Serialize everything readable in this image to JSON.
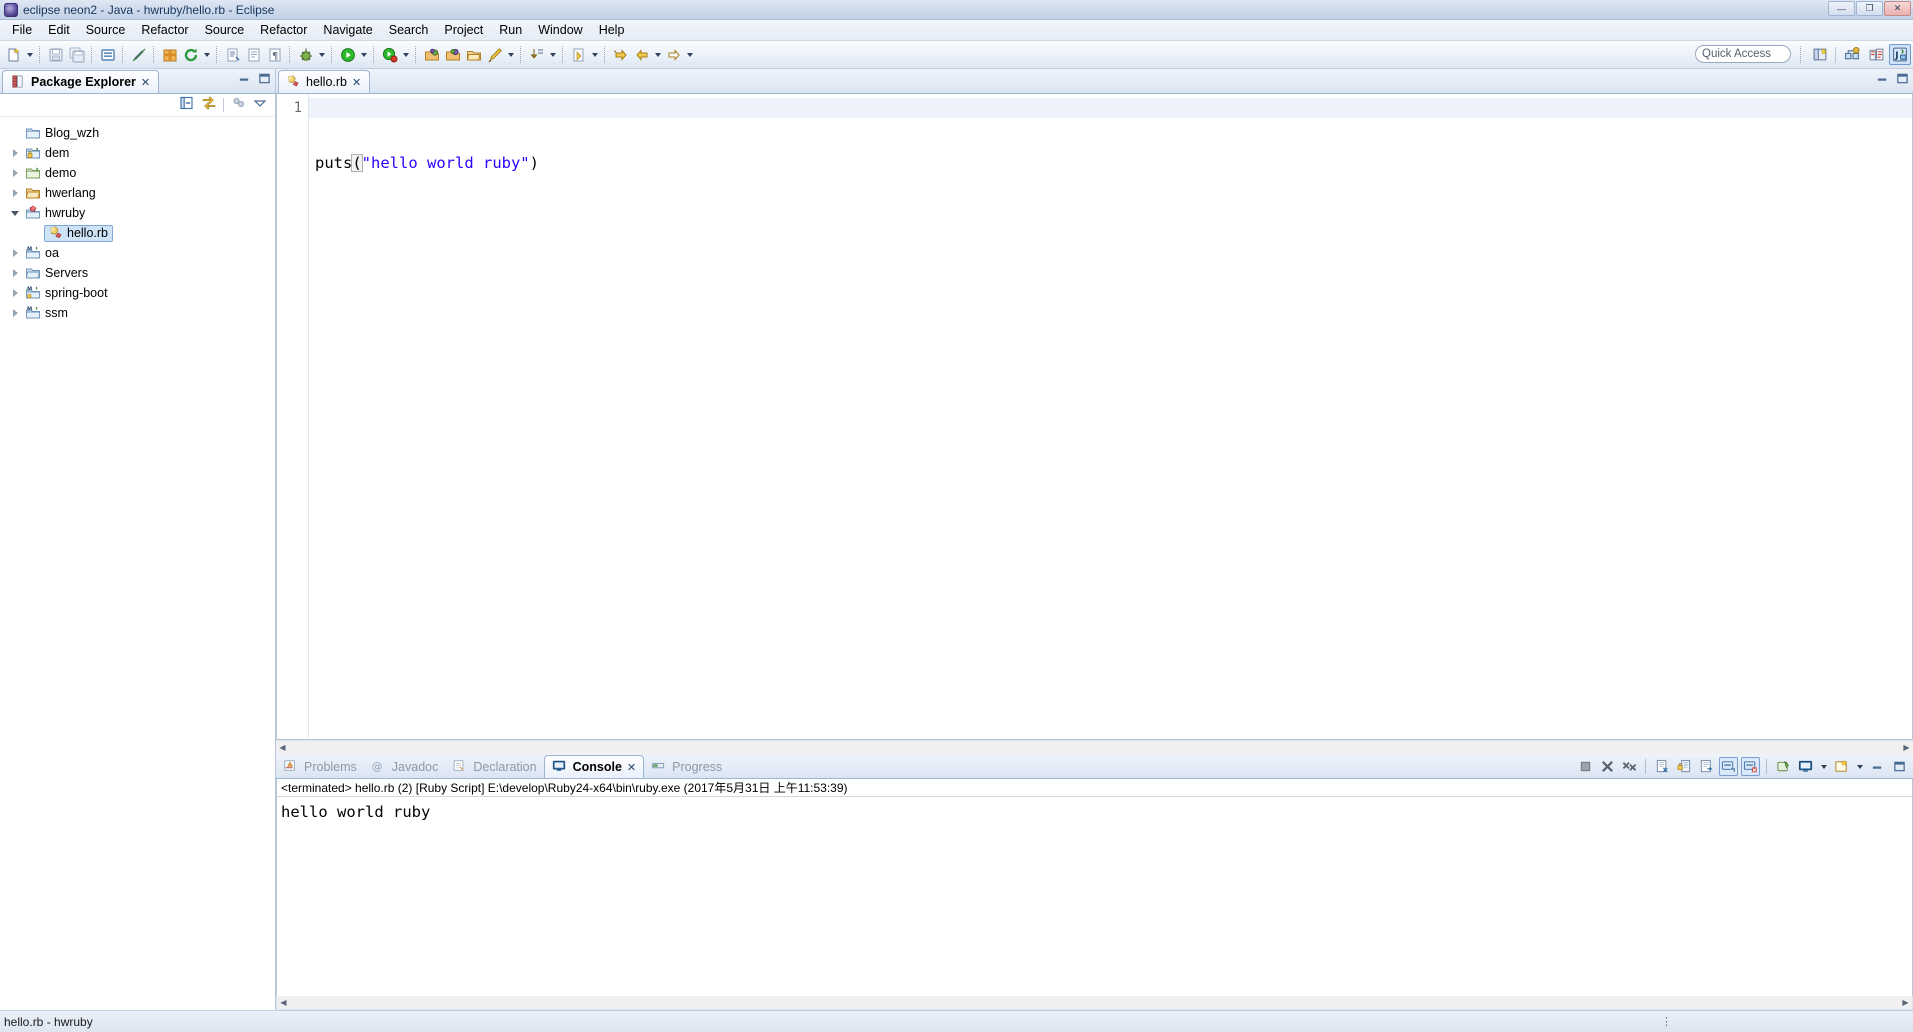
{
  "window": {
    "title": "eclipse neon2 - Java - hwruby/hello.rb - Eclipse",
    "icon": "eclipse-icon",
    "minimize_label": "—",
    "maximize_label": "❐",
    "close_label": "✕"
  },
  "menubar": {
    "items": [
      {
        "label": "File",
        "mnemonic": "F"
      },
      {
        "label": "Edit",
        "mnemonic": "E"
      },
      {
        "label": "Source",
        "mnemonic": "S"
      },
      {
        "label": "Refactor",
        "mnemonic": "t"
      },
      {
        "label": "Source",
        "mnemonic": "S"
      },
      {
        "label": "Refactor",
        "mnemonic": "t"
      },
      {
        "label": "Navigate",
        "mnemonic": "N"
      },
      {
        "label": "Search",
        "mnemonic": "a"
      },
      {
        "label": "Project",
        "mnemonic": "P"
      },
      {
        "label": "Run",
        "mnemonic": "R"
      },
      {
        "label": "Window",
        "mnemonic": "W"
      },
      {
        "label": "Help",
        "mnemonic": "H"
      }
    ]
  },
  "toolbar": {
    "groups": [
      {
        "buttons": [
          {
            "name": "new-wizard-button",
            "icon": "new-file-icon",
            "has_dropdown": true
          }
        ]
      },
      {
        "buttons": [
          {
            "name": "save-button",
            "icon": "save-icon",
            "has_dropdown": false
          },
          {
            "name": "save-all-button",
            "icon": "save-all-icon",
            "has_dropdown": false
          }
        ]
      },
      {
        "buttons": [
          {
            "name": "toggle-comment-button",
            "icon": "comment-block-icon",
            "has_dropdown": false
          }
        ]
      },
      {
        "buttons": [
          {
            "name": "quick-fix-button",
            "icon": "pencil-strike-icon",
            "has_dropdown": false
          }
        ]
      },
      {
        "buttons": [
          {
            "name": "new-package-button",
            "icon": "package-icon",
            "has_dropdown": false
          },
          {
            "name": "refresh-button",
            "icon": "refresh-icon",
            "has_dropdown": true
          }
        ]
      },
      {
        "buttons": [
          {
            "name": "open-type-button",
            "icon": "open-type-icon",
            "has_dropdown": false
          },
          {
            "name": "open-task-button",
            "icon": "document-icon",
            "has_dropdown": false
          },
          {
            "name": "paragraph-button",
            "icon": "paragraph-icon",
            "has_dropdown": false
          }
        ]
      },
      {
        "buttons": [
          {
            "name": "debug-button",
            "icon": "debug-bug-icon",
            "has_dropdown": true
          }
        ]
      },
      {
        "buttons": [
          {
            "name": "run-button",
            "icon": "run-green-play-icon",
            "has_dropdown": true
          }
        ]
      },
      {
        "buttons": [
          {
            "name": "run-coverage-button",
            "icon": "coverage-icon",
            "has_dropdown": true
          }
        ]
      },
      {
        "buttons": [
          {
            "name": "open-server-button",
            "icon": "server-open-icon",
            "has_dropdown": false
          },
          {
            "name": "new-server-button",
            "icon": "server-new-icon",
            "has_dropdown": false
          },
          {
            "name": "export-button",
            "icon": "export-folder-icon",
            "has_dropdown": false
          },
          {
            "name": "search-ref-button",
            "icon": "pen-icon",
            "has_dropdown": true
          }
        ]
      },
      {
        "buttons": [
          {
            "name": "next-annotation-button",
            "icon": "next-annotation-icon",
            "has_dropdown": true
          }
        ]
      },
      {
        "buttons": [
          {
            "name": "previous-edit-button",
            "icon": "last-edit-icon",
            "has_dropdown": true
          }
        ]
      },
      {
        "buttons": [
          {
            "name": "forward-nav-button",
            "icon": "arrow-right-yellow-icon",
            "has_dropdown": false
          },
          {
            "name": "back-nav-button",
            "icon": "arrow-left-yellow-icon",
            "has_dropdown": true
          },
          {
            "name": "forward-button",
            "icon": "arrow-right-outline-icon",
            "has_dropdown": true
          }
        ]
      }
    ],
    "quick_access": {
      "label": "Quick Access",
      "placeholder": "Quick Access"
    },
    "perspectives": [
      {
        "name": "open-perspective-button",
        "icon": "open-perspective-icon",
        "active": false
      },
      {
        "name": "perspective-java-ee-button",
        "icon": "java-ee-perspective-icon",
        "active": false
      },
      {
        "name": "perspective-debug-button",
        "icon": "debug-perspective-icon",
        "active": false
      },
      {
        "name": "perspective-java-button",
        "icon": "java-perspective-icon",
        "active": true
      }
    ]
  },
  "package_explorer": {
    "tab_label": "Package Explorer",
    "tab_icon": "package-explorer-icon",
    "close_label": "✕",
    "minimize_label": "—",
    "maximize_label": "❐",
    "toolbar": [
      {
        "name": "collapse-all-button",
        "icon": "collapse-all-icon"
      },
      {
        "name": "link-with-editor-button",
        "icon": "link-editor-icon"
      },
      {
        "name": "focus-on-active-task-button",
        "icon": "focus-task-icon"
      },
      {
        "name": "view-menu-button",
        "icon": "view-menu-chevron-icon"
      }
    ],
    "tree": [
      {
        "label": "Blog_wzh",
        "icon": "folder-plain-icon",
        "indent": 1,
        "state": "leaf",
        "selected": false
      },
      {
        "label": "dem",
        "icon": "java-project-locked-icon",
        "indent": 0,
        "state": "collapsed",
        "selected": false
      },
      {
        "label": "demo",
        "icon": "java-project-icon",
        "indent": 0,
        "state": "collapsed",
        "selected": false
      },
      {
        "label": "hwerlang",
        "icon": "folder-project-icon",
        "indent": 0,
        "state": "collapsed",
        "selected": false
      },
      {
        "label": "hwruby",
        "icon": "ruby-project-icon",
        "indent": 0,
        "state": "expanded",
        "selected": false
      },
      {
        "label": "hello.rb",
        "icon": "ruby-file-icon",
        "indent": 2,
        "state": "leaf",
        "selected": true
      },
      {
        "label": "oa",
        "icon": "maven-project-icon",
        "indent": 0,
        "state": "collapsed",
        "selected": false
      },
      {
        "label": "Servers",
        "icon": "folder-project-icon",
        "indent": 0,
        "state": "collapsed",
        "selected": false
      },
      {
        "label": "spring-boot",
        "icon": "maven-project-locked-icon",
        "indent": 0,
        "state": "collapsed",
        "selected": false
      },
      {
        "label": "ssm",
        "icon": "maven-project-icon",
        "indent": 0,
        "state": "collapsed",
        "selected": false
      }
    ]
  },
  "editor": {
    "tab_label": "hello.rb",
    "tab_icon": "ruby-file-icon",
    "close_label": "✕",
    "minimize_label": "—",
    "maximize_label": "❐",
    "line_numbers": [
      "1"
    ],
    "code": {
      "prefix": "puts",
      "open_paren": "(",
      "string": "\"hello world ruby\"",
      "close_paren": ")",
      "full_line": "puts(\"hello world ruby\")"
    },
    "colors": {
      "string": "#2a00ff",
      "default": "#000000",
      "line_highlight": "#eef3fb"
    }
  },
  "bottom_panel": {
    "tabs": [
      {
        "label": "Problems",
        "icon": "problems-icon",
        "active": false
      },
      {
        "label": "Javadoc",
        "icon": "javadoc-at-icon",
        "active": false
      },
      {
        "label": "Declaration",
        "icon": "declaration-icon",
        "active": false
      },
      {
        "label": "Console",
        "icon": "console-icon",
        "active": true
      },
      {
        "label": "Progress",
        "icon": "progress-icon",
        "active": false
      }
    ],
    "close_label": "✕",
    "minimize_label": "—",
    "maximize_label": "❐",
    "toolbar": [
      {
        "name": "terminate-button",
        "icon": "terminate-square-icon",
        "toggled": false
      },
      {
        "name": "remove-launch-button",
        "icon": "remove-x-icon",
        "toggled": false
      },
      {
        "name": "remove-all-terminated-button",
        "icon": "remove-all-xx-icon",
        "toggled": false
      },
      {
        "name": "clear-console-button",
        "icon": "clear-console-icon",
        "toggled": false
      },
      {
        "name": "scroll-lock-button",
        "icon": "scroll-lock-icon",
        "toggled": false
      },
      {
        "name": "word-wrap-button",
        "icon": "word-wrap-icon",
        "toggled": false
      },
      {
        "name": "show-console-on-output-button",
        "icon": "console-out-icon",
        "toggled": true
      },
      {
        "name": "show-console-on-error-button",
        "icon": "console-err-icon",
        "toggled": true
      },
      {
        "name": "pin-console-button",
        "icon": "pin-console-icon",
        "toggled": false
      },
      {
        "name": "display-selected-console-button",
        "icon": "display-console-icon",
        "toggled": false,
        "has_dropdown": true
      },
      {
        "name": "open-console-button",
        "icon": "open-console-icon",
        "toggled": false,
        "has_dropdown": true
      }
    ],
    "console": {
      "status_line": "<terminated> hello.rb (2) [Ruby Script] E:\\develop\\Ruby24-x64\\bin\\ruby.exe (2017年5月31日 上午11:53:39)",
      "output": "hello world ruby"
    }
  },
  "statusbar": {
    "text": "hello.rb - hwruby",
    "grip": "⋮"
  }
}
